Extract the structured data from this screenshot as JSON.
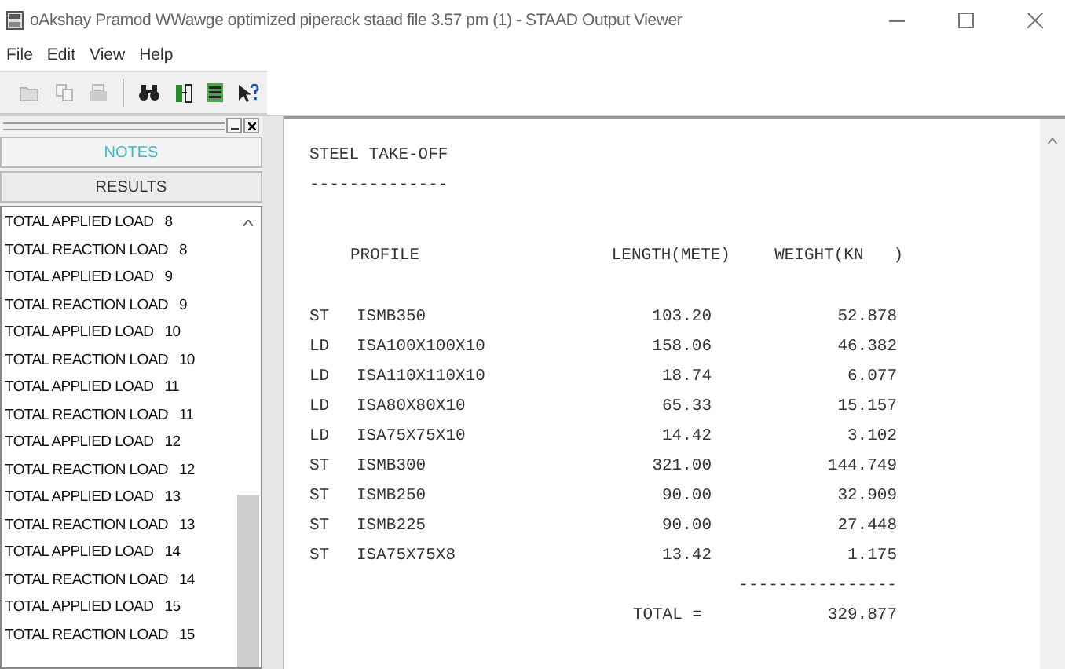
{
  "window": {
    "title": "oAkshay Pramod WWawge optimized piperack staad file 3.57 pm (1) - STAAD Output Viewer"
  },
  "menu": [
    "File",
    "Edit",
    "View",
    "Help"
  ],
  "toolbar": [
    {
      "kind": "open",
      "disabled": true
    },
    {
      "kind": "copy",
      "disabled": true
    },
    {
      "kind": "print",
      "disabled": true
    },
    {
      "kind": "find",
      "disabled": false
    },
    {
      "kind": "goto",
      "disabled": false
    },
    {
      "kind": "list",
      "disabled": false
    },
    {
      "kind": "help",
      "disabled": false
    }
  ],
  "sidebar": {
    "tabs": [
      {
        "label": "NOTES",
        "selected": false
      },
      {
        "label": "RESULTS",
        "selected": true
      }
    ],
    "items": [
      "TOTAL APPLIED LOAD   8",
      "TOTAL REACTION LOAD   8",
      "TOTAL APPLIED LOAD   9",
      "TOTAL REACTION LOAD   9",
      "TOTAL APPLIED LOAD   10",
      "TOTAL REACTION LOAD   10",
      "TOTAL APPLIED LOAD   11",
      "TOTAL REACTION LOAD   11",
      "TOTAL APPLIED LOAD   12",
      "TOTAL REACTION LOAD   12",
      "TOTAL APPLIED LOAD   13",
      "TOTAL REACTION LOAD   13",
      "TOTAL APPLIED LOAD   14",
      "TOTAL REACTION LOAD   14",
      "TOTAL APPLIED LOAD   15",
      "TOTAL REACTION LOAD   15"
    ]
  },
  "report": {
    "title": "STEEL TAKE-OFF",
    "underline": "--------------",
    "columns": [
      "",
      "PROFILE",
      "LENGTH(METE)",
      "WEIGHT(KN   )"
    ],
    "rows": [
      [
        "ST",
        "ISMB350",
        "103.20",
        "52.878"
      ],
      [
        "LD",
        "ISA100X100X10",
        "158.06",
        "46.382"
      ],
      [
        "LD",
        "ISA110X110X10",
        "18.74",
        "6.077"
      ],
      [
        "LD",
        "ISA80X80X10",
        "65.33",
        "15.157"
      ],
      [
        "LD",
        "ISA75X75X10",
        "14.42",
        "3.102"
      ],
      [
        "ST",
        "ISMB300",
        "321.00",
        "144.749"
      ],
      [
        "ST",
        "ISMB250",
        "90.00",
        "32.909"
      ],
      [
        "ST",
        "ISMB225",
        "90.00",
        "27.448"
      ],
      [
        "ST",
        "ISA75X75X8",
        "13.42",
        "1.175"
      ]
    ],
    "total_rule": "----------------",
    "total_label": "TOTAL =",
    "total": "329.877"
  }
}
